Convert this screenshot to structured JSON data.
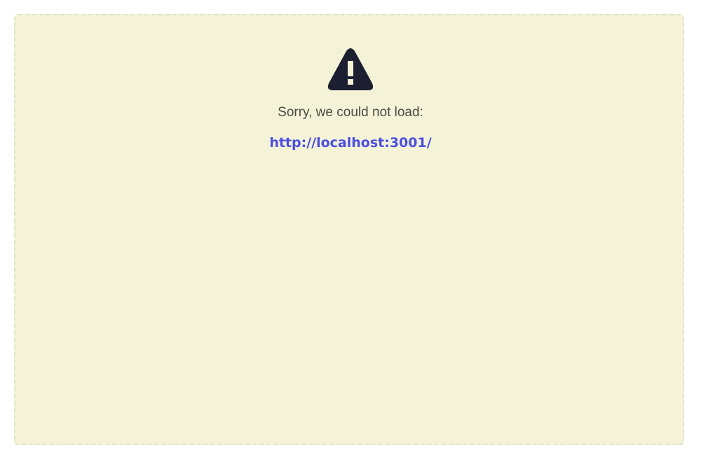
{
  "error": {
    "icon": "warning-triangle-icon",
    "message": "Sorry, we could not load:",
    "url": "http://localhost:3001/",
    "colors": {
      "background": "#f5f3d7",
      "link": "#4b4ee0",
      "icon": "#1b1f30"
    }
  }
}
